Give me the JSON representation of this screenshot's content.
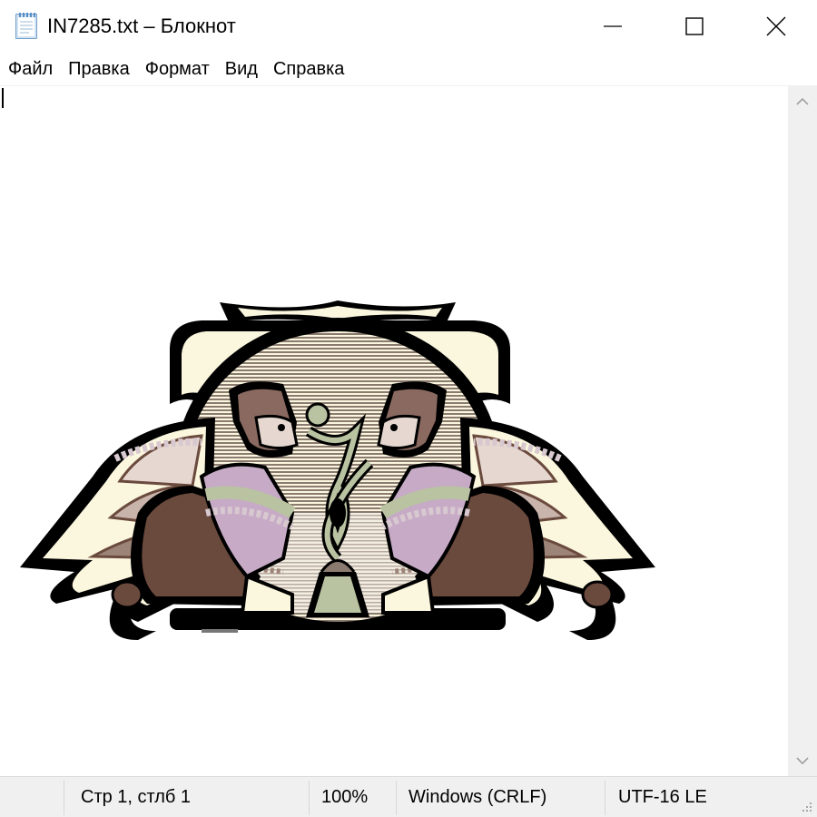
{
  "window": {
    "title": "IN7285.txt – Блокнот",
    "title_icon": "notepad-icon",
    "controls": {
      "minimize_icon": "minimize-icon",
      "maximize_icon": "maximize-icon",
      "close_icon": "close-icon"
    }
  },
  "menu": {
    "items": [
      {
        "label": "Файл"
      },
      {
        "label": "Правка"
      },
      {
        "label": "Формат"
      },
      {
        "label": "Вид"
      },
      {
        "label": "Справка"
      }
    ]
  },
  "editor": {
    "content_description_icon": "winged-sphinxes-picture-icon"
  },
  "scrollbar": {
    "up_icon": "scroll-up-icon",
    "down_icon": "scroll-down-icon"
  },
  "status": {
    "position": "Стр 1, стлб 1",
    "zoom": "100%",
    "line_endings": "Windows (CRLF)",
    "encoding": "UTF-16 LE"
  },
  "colors": {
    "dark": "#000000",
    "cream": "#fbf6de",
    "brown": "#6b4a3e",
    "taupe": "#9c8578",
    "sage": "#b9c3a2",
    "lilac": "#c6aac6",
    "pale_rose": "#e6d8d0",
    "status_bg": "#f0f0f0"
  }
}
